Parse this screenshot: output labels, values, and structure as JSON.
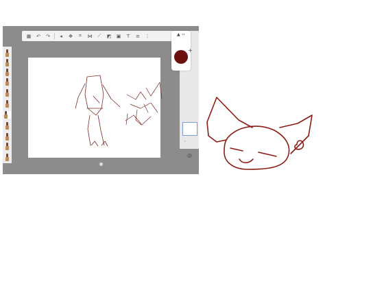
{
  "app": {
    "toolbar_tools": [
      "undo-icon",
      "redo-icon",
      "brush-icon",
      "transform-icon",
      "crop-icon",
      "symmetry-icon",
      "ruler-icon",
      "fill-icon",
      "image-icon",
      "text-icon",
      "layers-icon",
      "more-icon"
    ],
    "brushes": [
      "brush-1",
      "brush-2",
      "brush-3",
      "brush-4",
      "brush-5",
      "brush-6",
      "brush-7",
      "brush-8",
      "brush-9",
      "brush-10",
      "brush-11"
    ],
    "active_brush_index": 6,
    "current_color": "#6b0f0f",
    "accent_color": "#7aa0d0"
  },
  "doodle": {
    "stroke_color": "#8b1a10"
  }
}
